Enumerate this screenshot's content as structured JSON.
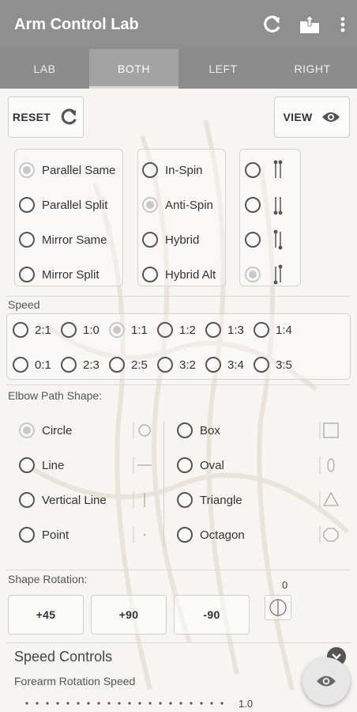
{
  "app": {
    "title": "Arm Control Lab"
  },
  "tabs": [
    {
      "label": "LAB",
      "active": false
    },
    {
      "label": "BOTH",
      "active": true
    },
    {
      "label": "LEFT",
      "active": false
    },
    {
      "label": "RIGHT",
      "active": false
    }
  ],
  "toolbar": {
    "reset_label": "RESET",
    "view_label": "VIEW"
  },
  "mode": {
    "group1": [
      {
        "label": "Parallel Same",
        "checked": true
      },
      {
        "label": "Parallel Split",
        "checked": false
      },
      {
        "label": "Mirror Same",
        "checked": false
      },
      {
        "label": "Mirror Split",
        "checked": false
      }
    ],
    "group2": [
      {
        "label": "In-Spin",
        "checked": false
      },
      {
        "label": "Anti-Spin",
        "checked": true
      },
      {
        "label": "Hybrid",
        "checked": false
      },
      {
        "label": "Hybrid Alt",
        "checked": false
      }
    ],
    "group3": [
      {
        "icon": "both-up-icon",
        "checked": false
      },
      {
        "icon": "both-down-icon",
        "checked": false
      },
      {
        "icon": "up-down-icon",
        "checked": false
      },
      {
        "icon": "down-up-icon",
        "checked": true
      }
    ]
  },
  "speed": {
    "label": "Speed",
    "row1": [
      {
        "label": "2:1",
        "checked": false
      },
      {
        "label": "1:0",
        "checked": false
      },
      {
        "label": "1:1",
        "checked": true
      },
      {
        "label": "1:2",
        "checked": false
      },
      {
        "label": "1:3",
        "checked": false
      },
      {
        "label": "1:4",
        "checked": false
      }
    ],
    "row2": [
      {
        "label": "0:1",
        "checked": false
      },
      {
        "label": "2:3",
        "checked": false
      },
      {
        "label": "2:5",
        "checked": false
      },
      {
        "label": "3:2",
        "checked": false
      },
      {
        "label": "3:4",
        "checked": false
      },
      {
        "label": "3:5",
        "checked": false
      }
    ]
  },
  "elbow": {
    "label": "Elbow Path Shape:",
    "left": [
      {
        "label": "Circle",
        "checked": true,
        "icon": "circle-shape-icon"
      },
      {
        "label": "Line",
        "checked": false,
        "icon": "line-shape-icon"
      },
      {
        "label": "Vertical Line",
        "checked": false,
        "icon": "vertical-line-shape-icon"
      },
      {
        "label": "Point",
        "checked": false,
        "icon": "point-shape-icon"
      }
    ],
    "right": [
      {
        "label": "Box",
        "checked": false,
        "icon": "box-shape-icon"
      },
      {
        "label": "Oval",
        "checked": false,
        "icon": "oval-shape-icon"
      },
      {
        "label": "Triangle",
        "checked": false,
        "icon": "triangle-shape-icon"
      },
      {
        "label": "Octagon",
        "checked": false,
        "icon": "octagon-shape-icon"
      }
    ]
  },
  "rotation": {
    "label": "Shape Rotation:",
    "buttons": [
      "+45",
      "+90",
      "-90"
    ],
    "value": "0"
  },
  "speed_controls": {
    "title": "Speed Controls",
    "forearm_label": "Forearm Rotation Speed",
    "forearm_value": "1.0"
  },
  "colors": {
    "appbar": "#8f8f8f",
    "accent": "#555555"
  }
}
